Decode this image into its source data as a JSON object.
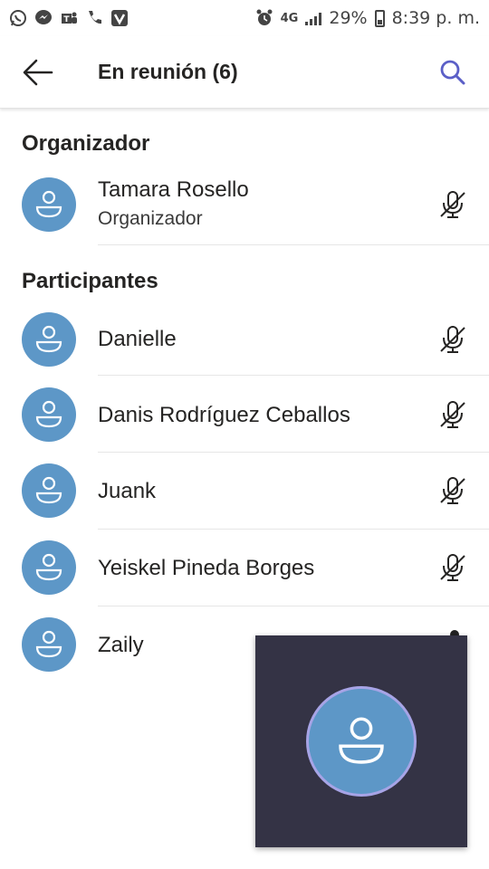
{
  "status_bar": {
    "network": "4G",
    "battery": "29%",
    "time": "8:39 p. m."
  },
  "header": {
    "title": "En reunión (6)"
  },
  "organizer_section": {
    "title": "Organizador",
    "people": [
      {
        "name": "Tamara Rosello",
        "role": "Organizador",
        "muted": true
      }
    ]
  },
  "participants_section": {
    "title": "Participantes",
    "people": [
      {
        "name": "Danielle",
        "muted": true
      },
      {
        "name": "Danis Rodríguez Ceballos",
        "muted": true
      },
      {
        "name": "Juank",
        "muted": true
      },
      {
        "name": "Yeiskel Pineda Borges",
        "muted": true
      },
      {
        "name": "Zaily",
        "muted": false
      }
    ]
  },
  "colors": {
    "avatar": "#5d97c7",
    "pip_background": "#343345",
    "pip_ring": "#a7a4e6",
    "search_icon": "#5b5fc7"
  },
  "icons": {
    "back": "arrow-left-icon",
    "search": "search-icon",
    "mic_off": "mic-off-icon",
    "avatar": "person-icon"
  }
}
